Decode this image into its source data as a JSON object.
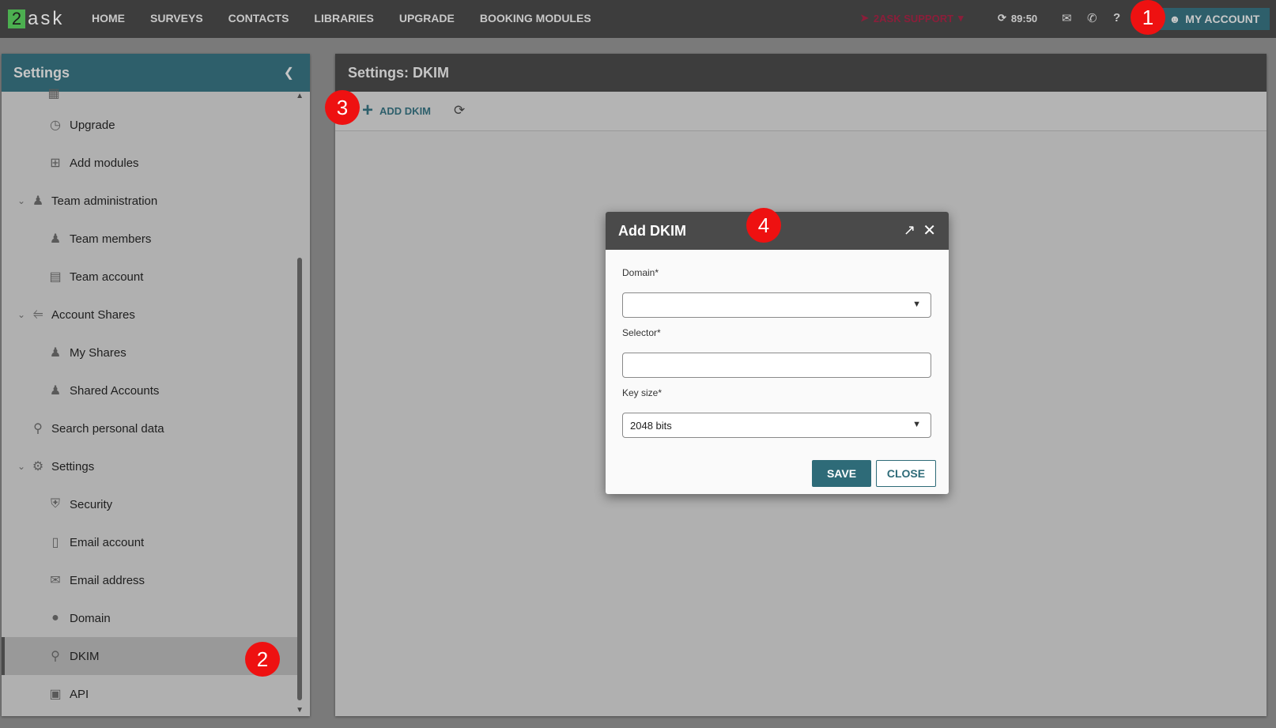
{
  "logo": {
    "two": "2",
    "ask": "ask"
  },
  "nav": [
    "HOME",
    "SURVEYS",
    "CONTACTS",
    "LIBRARIES",
    "UPGRADE",
    "BOOKING MODULES"
  ],
  "support_label": "2ASK SUPPORT",
  "timer": "89:50",
  "my_account": "MY ACCOUNT",
  "sidebar": {
    "title": "Settings",
    "items": [
      {
        "label": "Upgrade",
        "icon": "clock-icon",
        "level": 2
      },
      {
        "label": "Add modules",
        "icon": "add-box-icon",
        "level": 2
      },
      {
        "label": "Team administration",
        "icon": "people-icon",
        "level": 1
      },
      {
        "label": "Team members",
        "icon": "person-icon",
        "level": 2
      },
      {
        "label": "Team account",
        "icon": "list-icon",
        "level": 2
      },
      {
        "label": "Account Shares",
        "icon": "share-icon",
        "level": 1
      },
      {
        "label": "My Shares",
        "icon": "person-icon",
        "level": 2
      },
      {
        "label": "Shared Accounts",
        "icon": "people-icon",
        "level": 2
      },
      {
        "label": "Search personal data",
        "icon": "search-icon",
        "level": 1
      },
      {
        "label": "Settings",
        "icon": "gear-icon",
        "level": 1
      },
      {
        "label": "Security",
        "icon": "shield-icon",
        "level": 2
      },
      {
        "label": "Email account",
        "icon": "inbox-icon",
        "level": 2
      },
      {
        "label": "Email address",
        "icon": "mail-icon",
        "level": 2
      },
      {
        "label": "Domain",
        "icon": "globe-icon",
        "level": 2
      },
      {
        "label": "DKIM",
        "icon": "key-icon",
        "level": 2
      },
      {
        "label": "API",
        "icon": "chip-icon",
        "level": 2
      }
    ]
  },
  "main": {
    "title": "Settings: DKIM",
    "add_label": "ADD DKIM"
  },
  "dialog": {
    "title": "Add DKIM",
    "domain_label": "Domain*",
    "domain_value": "",
    "selector_label": "Selector*",
    "selector_value": "",
    "keysize_label": "Key size*",
    "keysize_value": "2048 bits",
    "save_label": "SAVE",
    "close_label": "CLOSE"
  },
  "callouts": [
    "1",
    "2",
    "3",
    "4"
  ]
}
